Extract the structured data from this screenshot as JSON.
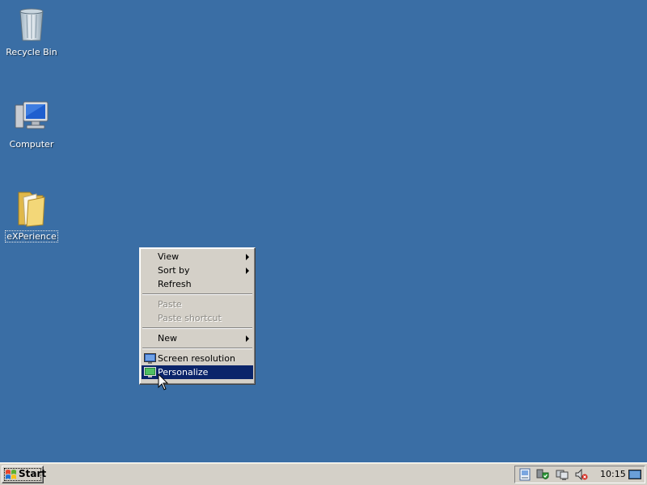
{
  "desktop": {
    "background": "#3a6ea5",
    "icons": [
      {
        "label": "Recycle Bin",
        "icon": "recycle-bin-icon"
      },
      {
        "label": "Computer",
        "icon": "computer-icon"
      },
      {
        "label": "eXPerience",
        "icon": "folder-icon"
      }
    ]
  },
  "context_menu": {
    "items": [
      {
        "label": "View",
        "has_submenu": true,
        "enabled": true
      },
      {
        "label": "Sort by",
        "has_submenu": true,
        "enabled": true
      },
      {
        "label": "Refresh",
        "enabled": true
      },
      {
        "label": "Paste",
        "enabled": false
      },
      {
        "label": "Paste shortcut",
        "enabled": false
      },
      {
        "label": "New",
        "has_submenu": true,
        "enabled": true
      },
      {
        "label": "Screen resolution",
        "icon": "screen-resolution-icon",
        "enabled": true
      },
      {
        "label": "Personalize",
        "icon": "personalize-icon",
        "enabled": true,
        "highlighted": true
      }
    ],
    "highlight_color": "#0a246a"
  },
  "taskbar": {
    "start_label": "Start",
    "tray_icons": [
      "network-icon",
      "security-shield-icon",
      "display-icon",
      "volume-muted-icon"
    ],
    "clock": "10:15"
  }
}
